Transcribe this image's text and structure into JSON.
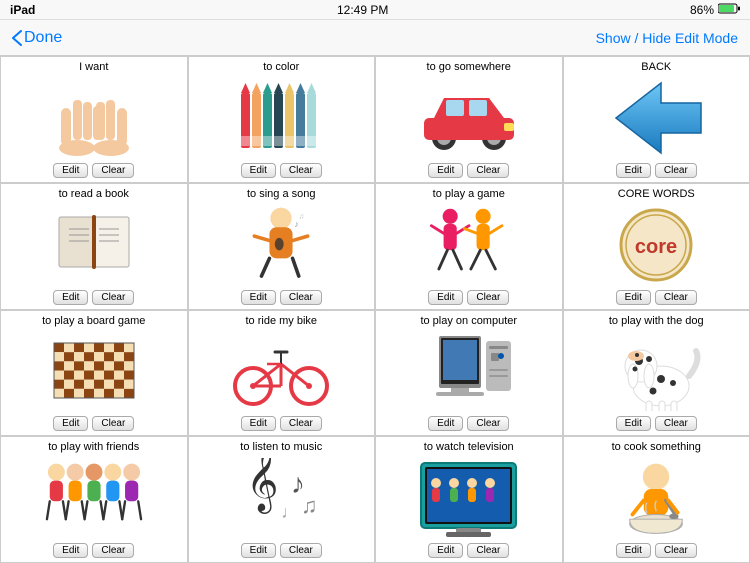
{
  "status": {
    "left": "iPad",
    "time": "12:49 PM",
    "battery": "86%"
  },
  "nav": {
    "back_label": "Done",
    "right_label": "Show / Hide Edit Mode"
  },
  "cells": [
    {
      "id": "i-want",
      "title": "I want",
      "icon": "hands",
      "edit_label": "Edit",
      "clear_label": "Clear"
    },
    {
      "id": "to-color",
      "title": "to color",
      "icon": "crayons",
      "edit_label": "Edit",
      "clear_label": "Clear"
    },
    {
      "id": "to-go-somewhere",
      "title": "to go somewhere",
      "icon": "car",
      "edit_label": "Edit",
      "clear_label": "Clear"
    },
    {
      "id": "back",
      "title": "BACK",
      "icon": "back-arrow",
      "edit_label": "Edit",
      "clear_label": "Clear"
    },
    {
      "id": "to-read-a-book",
      "title": "to read a book",
      "icon": "book",
      "edit_label": "Edit",
      "clear_label": "Clear"
    },
    {
      "id": "to-sing-a-song",
      "title": "to sing a song",
      "icon": "singing",
      "edit_label": "Edit",
      "clear_label": "Clear"
    },
    {
      "id": "to-play-a-game",
      "title": "to play a game",
      "icon": "dancing",
      "edit_label": "Edit",
      "clear_label": "Clear"
    },
    {
      "id": "core-words",
      "title": "CORE WORDS",
      "icon": "core",
      "edit_label": "Edit",
      "clear_label": "Clear"
    },
    {
      "id": "to-play-a-board-game",
      "title": "to play a board game",
      "icon": "checkerboard",
      "edit_label": "Edit",
      "clear_label": "Clear"
    },
    {
      "id": "to-ride-my-bike",
      "title": "to ride my bike",
      "icon": "bike",
      "edit_label": "Edit",
      "clear_label": "Clear"
    },
    {
      "id": "to-play-on-computer",
      "title": "to play on computer",
      "icon": "computer",
      "edit_label": "Edit",
      "clear_label": "Clear"
    },
    {
      "id": "to-play-with-the-dog",
      "title": "to play with the dog",
      "icon": "dog",
      "edit_label": "Edit",
      "clear_label": "Clear"
    },
    {
      "id": "to-play-with-friends",
      "title": "to play with friends",
      "icon": "friends",
      "edit_label": "Edit",
      "clear_label": "Clear"
    },
    {
      "id": "to-listen-to-music",
      "title": "to listen to music",
      "icon": "music",
      "edit_label": "Edit",
      "clear_label": "Clear"
    },
    {
      "id": "to-watch-television",
      "title": "to watch television",
      "icon": "tv",
      "edit_label": "Edit",
      "clear_label": "Clear"
    },
    {
      "id": "to-cook-something",
      "title": "to cook something",
      "icon": "cooking",
      "edit_label": "Edit",
      "clear_label": "Clear"
    }
  ]
}
